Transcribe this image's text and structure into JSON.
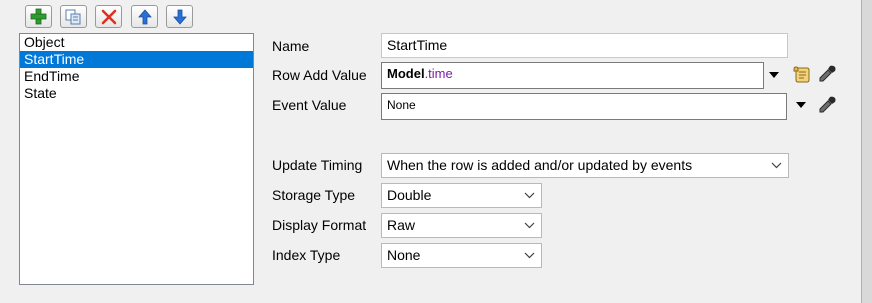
{
  "toolbar": {
    "add_icon": "plus-icon",
    "duplicate_icon": "copy-icon",
    "delete_icon": "x-icon",
    "move_up_icon": "arrow-up-icon",
    "move_down_icon": "arrow-down-icon"
  },
  "columns_list": {
    "items": [
      "Object",
      "StartTime",
      "EndTime",
      "State"
    ],
    "selected": "StartTime"
  },
  "properties": {
    "name_label": "Name",
    "name_value": "StartTime",
    "row_add_value_label": "Row Add Value",
    "row_add_value_keyword": "Model",
    "row_add_value_property": ".time",
    "event_value_label": "Event Value",
    "event_value": "None",
    "update_timing_label": "Update Timing",
    "update_timing_value": "When the row is added and/or updated by events",
    "storage_type_label": "Storage Type",
    "storage_type_value": "Double",
    "display_format_label": "Display Format",
    "display_format_value": "Raw",
    "index_type_label": "Index Type",
    "index_type_value": "None"
  },
  "colors": {
    "selection": "#0078d7",
    "add_green": "#2e9b2e",
    "delete_red": "#e03020",
    "arrow_blue": "#2a6fd6",
    "property_purple": "#7a1fa2"
  }
}
